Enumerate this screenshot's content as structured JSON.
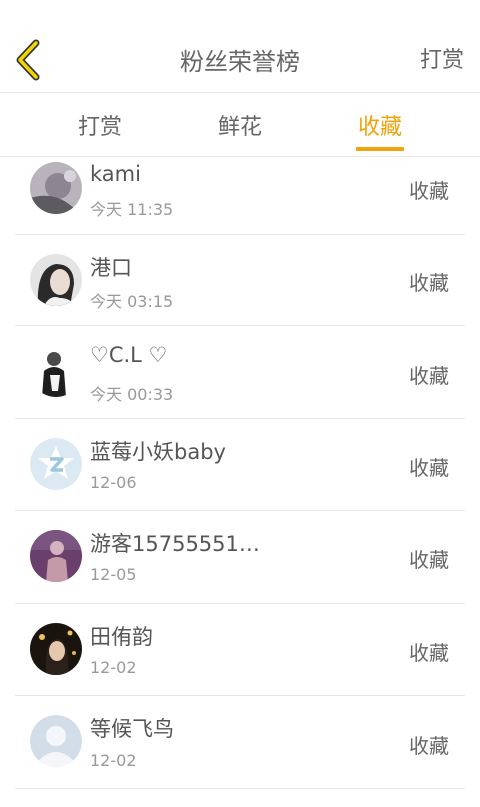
{
  "header": {
    "title": "粉丝荣誉榜",
    "right_action": "打赏"
  },
  "tabs": [
    {
      "label": "打赏",
      "active": false
    },
    {
      "label": "鲜花",
      "active": false
    },
    {
      "label": "收藏",
      "active": true
    }
  ],
  "colors": {
    "accent": "#f0a30a",
    "text": "#666666",
    "subtext": "#999999",
    "divider": "#e6e6e6"
  },
  "rows": [
    {
      "name": "kami",
      "time": "今天 11:35",
      "action": "收藏"
    },
    {
      "name": "港口",
      "time": "今天 03:15",
      "action": "收藏"
    },
    {
      "name": "♡C.L ♡",
      "time": "今天 00:33",
      "action": "收藏"
    },
    {
      "name": "蓝莓小妖baby",
      "time": "12-06",
      "action": "收藏"
    },
    {
      "name": "游客15755551…",
      "time": "12-05",
      "action": "收藏"
    },
    {
      "name": "田侑韵",
      "time": "12-02",
      "action": "收藏"
    },
    {
      "name": "等候飞鸟",
      "time": "12-02",
      "action": "收藏"
    }
  ]
}
